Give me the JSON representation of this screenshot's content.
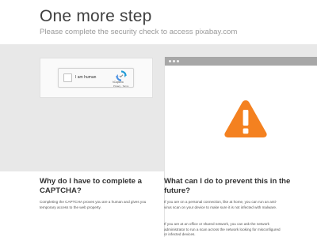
{
  "header": {
    "title": "One more step",
    "subtitle": "Please complete the security check to access pixabay.com"
  },
  "captcha": {
    "label": "I am human",
    "brand": "hCaptcha",
    "links": "Privacy · Terms",
    "checked": false
  },
  "icons": {
    "captcha_logo": "hcaptcha-logo-icon",
    "warning": "warning-triangle-icon"
  },
  "colors": {
    "band": "#e8e8e8",
    "browser_bar": "#a7a7a7",
    "warning": "#f48120",
    "captcha_logo": "#1e9ad6"
  },
  "faq": {
    "why_question": "Why do I have to complete a CAPTCHA?",
    "why_answer": "Completing the CAPTCHA proves you are a human and gives you temporary access to the web property.",
    "prevent_question": "What can I do to prevent this in the future?",
    "prevent_answer_1": "If you are on a personal connection, like at home, you can run an anti-virus scan on your device to make sure it is not infected with malware.",
    "prevent_answer_2": "If you are at an office or shared network, you can ask the network administrator to run a scan across the network looking for misconfigured or infected devices."
  }
}
